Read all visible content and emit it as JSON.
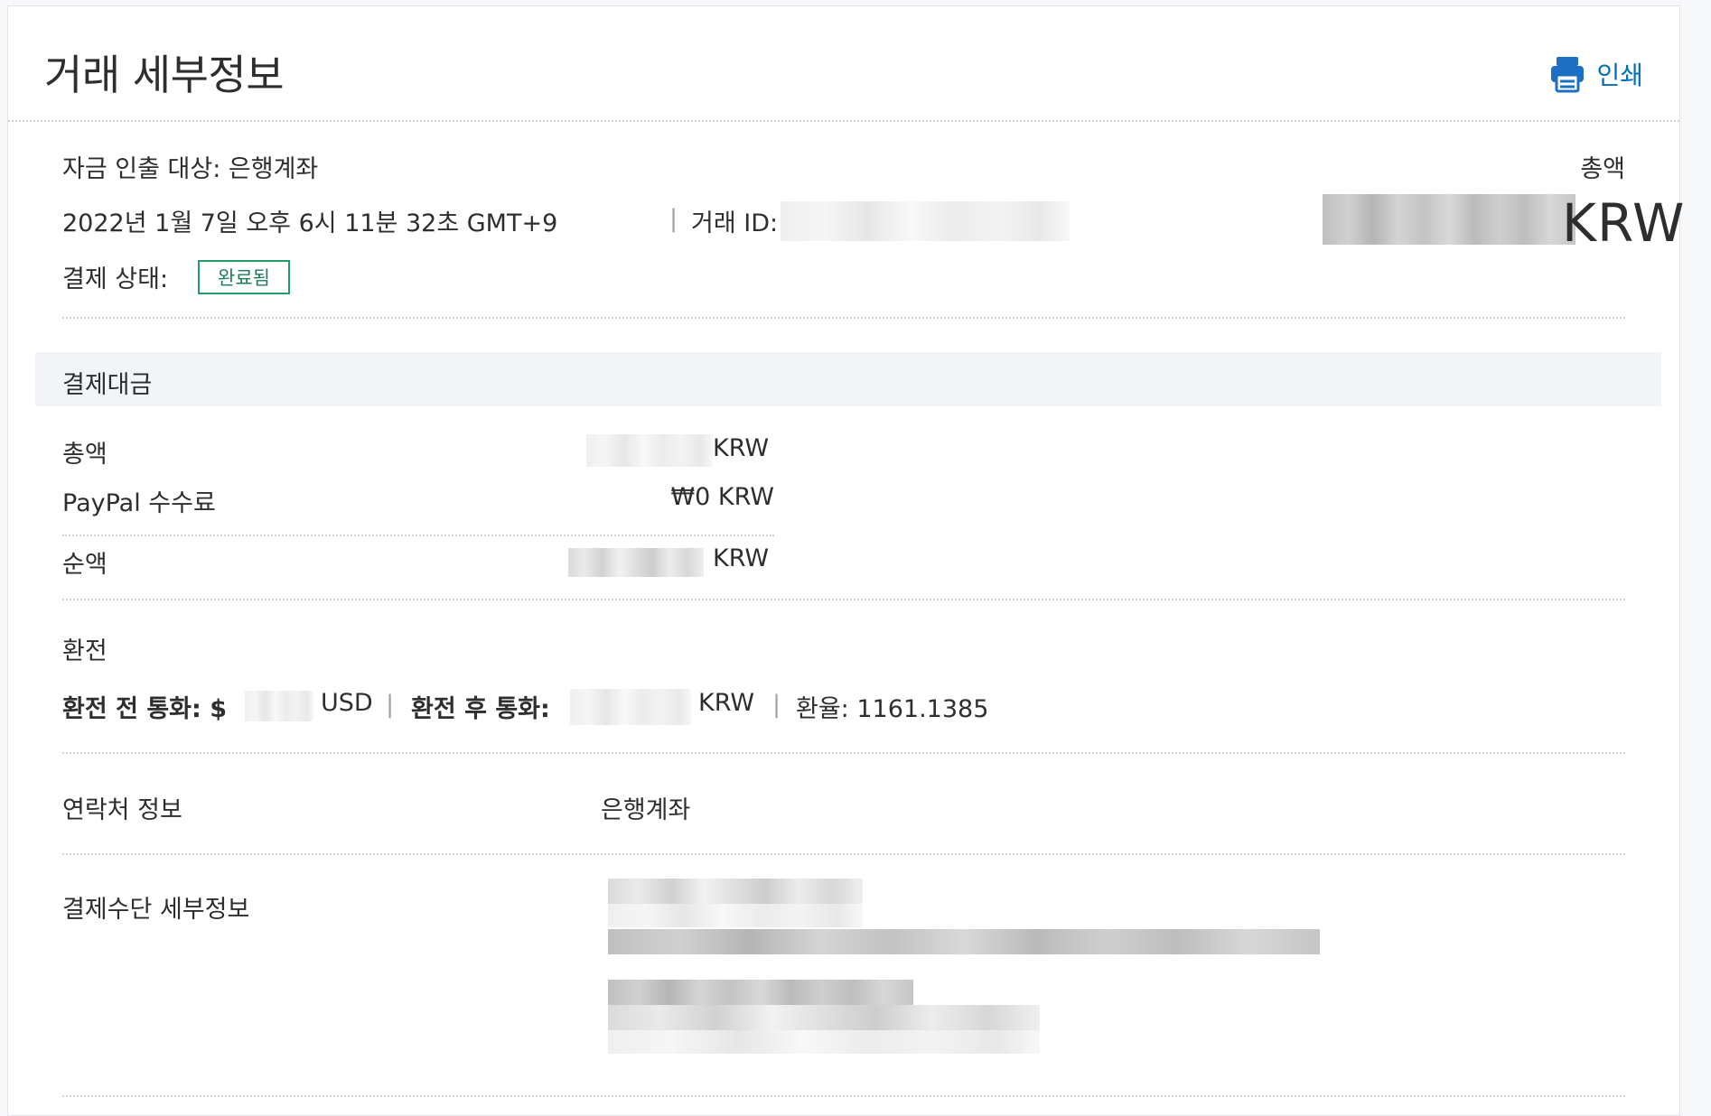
{
  "header": {
    "title": "거래 세부정보",
    "print_label": "인쇄"
  },
  "summary": {
    "withdraw_to": "자금 인출 대상: 은행계좌",
    "datetime": "2022년 1월 7일 오후 6시 11분 32초 GMT+9",
    "separator": "|",
    "transaction_id_label": "거래 ID:",
    "total_label": "총액",
    "total_currency": "KRW",
    "status_label": "결제 상태:",
    "status_value": "완료됨"
  },
  "payment": {
    "section_title": "결제대금",
    "rows": [
      {
        "label": "총액",
        "currency": "KRW"
      },
      {
        "label": "PayPal 수수료",
        "value": "₩0 KRW"
      },
      {
        "label": "순액",
        "currency": "KRW"
      }
    ]
  },
  "exchange": {
    "section_title": "환전",
    "from_label": "환전 전 통화: $",
    "from_currency": "USD",
    "to_label": "환전 후 통화:",
    "to_currency": "KRW",
    "rate": "환율: 1161.1385",
    "separator": "|"
  },
  "contact": {
    "label": "연락처 정보",
    "value": "은행계좌"
  },
  "method": {
    "label": "결제수단 세부정보"
  }
}
